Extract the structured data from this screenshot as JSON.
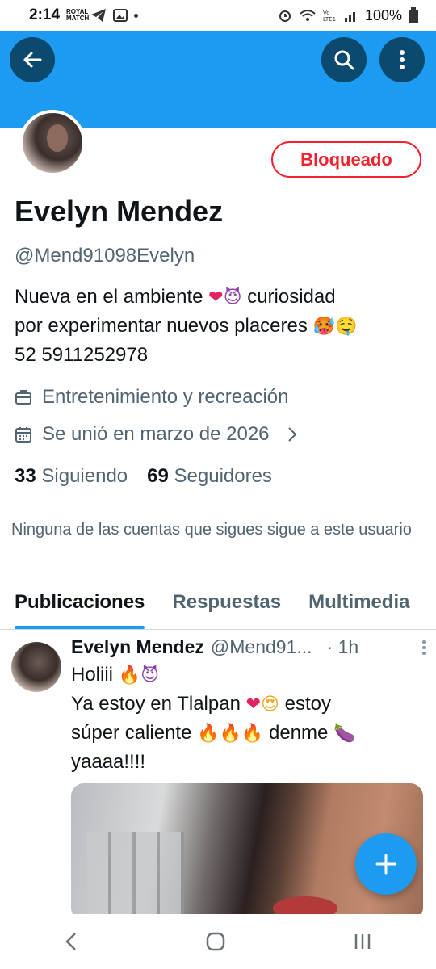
{
  "status_bar": {
    "time": "2:14",
    "mini_label": "ROYAL MATCH",
    "battery": "100%"
  },
  "profile": {
    "name": "Evelyn Mendez",
    "handle": "@Mend91098Evelyn",
    "blocked_label": "Bloqueado",
    "bio_line1_a": "Nueva en el ambiente",
    "bio_line1_b": "curiosidad",
    "bio_line2": "por experimentar nuevos placeres",
    "bio_line3": "52 5911252978",
    "category": "Entretenimiento y recreación",
    "joined": "Se unió en marzo de 2026",
    "following_count": "33",
    "following_label": "Siguiendo",
    "followers_count": "69",
    "followers_label": "Seguidores",
    "mutual_note": "Ninguna de las cuentas que sigues sigue a este usuario"
  },
  "tabs": [
    {
      "label": "Publicaciones"
    },
    {
      "label": "Respuestas"
    },
    {
      "label": "Multimedia"
    }
  ],
  "post": {
    "author": "Evelyn Mendez",
    "handle": "@Mend91...",
    "time": "· 1h",
    "line1": "Holiii",
    "line2_a": "Ya estoy en Tlalpan",
    "line2_b": "estoy",
    "line3_a": "súper caliente",
    "line3_b": "denme",
    "line4": "yaaaa!!!!"
  },
  "icons": {
    "back": "arrow-left-icon",
    "search": "search-icon",
    "more": "more-vertical-icon",
    "briefcase": "briefcase-icon",
    "calendar": "calendar-icon",
    "compose": "plus-icon"
  },
  "colors": {
    "brand": "#1d9bf0",
    "blocked": "#f4212e"
  }
}
